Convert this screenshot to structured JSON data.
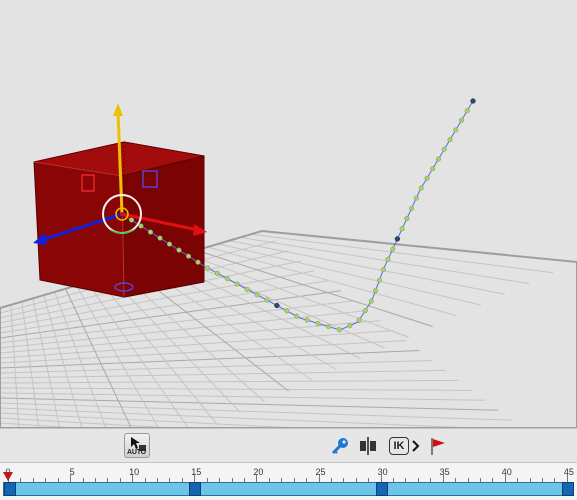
{
  "toolbar": {
    "auto_key_label": "AUTO",
    "ik_label": "IK"
  },
  "timeline": {
    "start_label": "0",
    "labels": [
      "5",
      "10",
      "15",
      "20",
      "25",
      "30",
      "35",
      "40",
      "45"
    ],
    "keyframes": [
      0,
      15,
      30,
      45
    ],
    "current_frame": 0
  },
  "colors": {
    "cube": "#9a0808",
    "path": "#9aca6a",
    "track": "#6cc4e8",
    "keyframe": "#1565b5",
    "playhead": "#c01818"
  }
}
